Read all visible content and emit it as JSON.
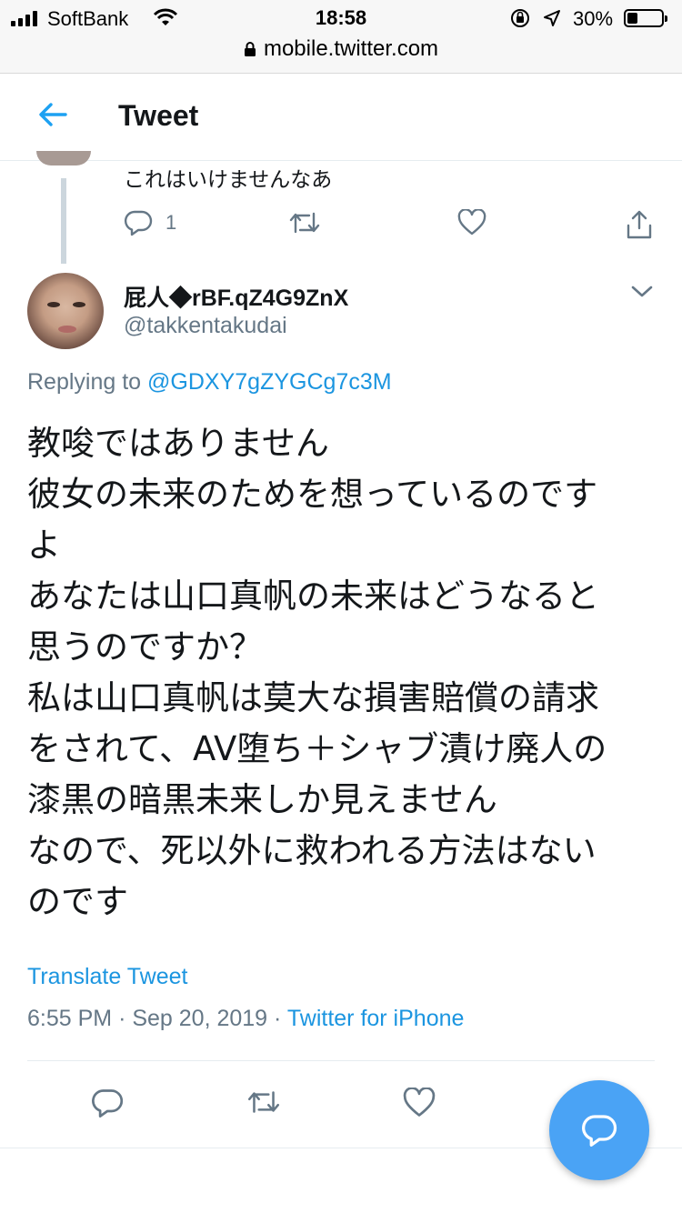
{
  "status_bar": {
    "carrier": "SoftBank",
    "time": "18:58",
    "battery_percent": "30%",
    "battery_level": 0.3
  },
  "browser": {
    "url": "mobile.twitter.com"
  },
  "header": {
    "title": "Tweet"
  },
  "previous_tweet": {
    "text": "これはいけませんなあ",
    "reply_count": "1"
  },
  "tweet": {
    "display_name": "屁人◆rBF.qZ4G9ZnX",
    "handle": "@takkentakudai",
    "replying_prefix": "Replying to",
    "replying_to": "@GDXY7gZYGCg7c3M",
    "lines": [
      "教唆ではありません",
      "彼女の未来のためを想っているのです",
      "よ",
      "あなたは山口真帆の未来はどうなると",
      "思うのですか？",
      "私は山口真帆は莫大な損害賠償の請求",
      "をされて、AV堕ち＋シャブ漬け廃人の",
      "漆黒の暗黒未来しか見えません",
      "なので、死以外に救われる方法はない",
      "のです"
    ],
    "translate_label": "Translate Tweet",
    "time": "6:55 PM",
    "date": "Sep 20, 2019",
    "separator": "·",
    "source": "Twitter for iPhone"
  },
  "colors": {
    "accent": "#1b95e0",
    "muted": "#657786",
    "fab": "#4aa3f5"
  }
}
